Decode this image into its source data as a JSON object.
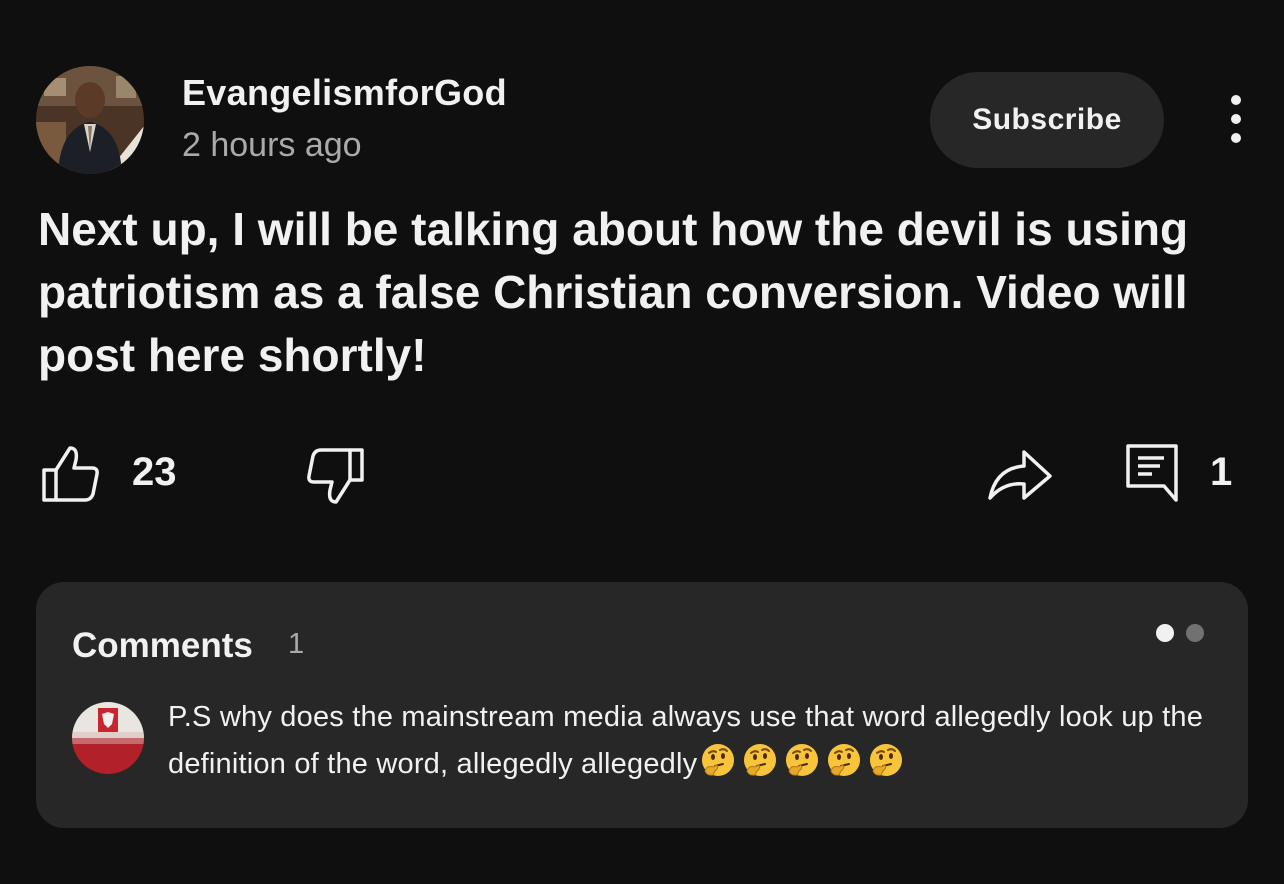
{
  "post": {
    "channel_name": "EvangelismforGod",
    "time_ago": "2 hours ago",
    "subscribe_label": "Subscribe",
    "text": "Next up, I will be talking about how the devil is using patriotism as a false Christian conversion. Video will post here shortly!",
    "like_count": "23",
    "comment_count": "1"
  },
  "comments_card": {
    "title": "Comments",
    "count": "1",
    "pagination": {
      "total": 2,
      "active_index": 0
    },
    "top_comment": {
      "text": "P.S why does the mainstream media always use that word allegedly look up the definition of the word, allegedly allegedly",
      "emoji": "thinking-face",
      "emoji_count": 5
    }
  },
  "icons": {
    "like": "thumbs-up-icon",
    "dislike": "thumbs-down-icon",
    "share": "share-arrow-icon",
    "comment": "comment-icon",
    "more": "vertical-dots-icon"
  },
  "colors": {
    "background": "#0f0f0f",
    "card": "#272727",
    "text_primary": "#f1f1f1",
    "text_secondary": "#aaaaaa"
  }
}
